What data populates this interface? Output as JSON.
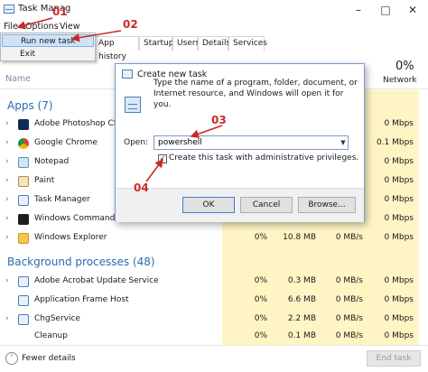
{
  "window": {
    "title": "Task Manag"
  },
  "menu": {
    "file": "File",
    "options": "Options",
    "view": "View"
  },
  "tabs": [
    "App history",
    "Startup",
    "Users",
    "Details",
    "Services"
  ],
  "columns": {
    "name": "Name",
    "network_pct": "0%",
    "network_label": "Network"
  },
  "sections": {
    "apps": "Apps (7)",
    "background": "Background processes (48)"
  },
  "apps": [
    {
      "name": "Adobe Photoshop CS2",
      "network": "0 Mbps"
    },
    {
      "name": "Google Chrome",
      "network": "0.1 Mbps"
    },
    {
      "name": "Notepad",
      "network": "0 Mbps"
    },
    {
      "name": "Paint",
      "network": "0 Mbps"
    },
    {
      "name": "Task Manager",
      "network": "0 Mbps"
    },
    {
      "name": "Windows Command Pr",
      "network": "0 Mbps"
    },
    {
      "name": "Windows Explorer",
      "cpu": "0%",
      "memory": "10.8 MB",
      "disk": "0 MB/s",
      "network": "0 Mbps"
    }
  ],
  "background": [
    {
      "name": "Adobe Acrobat Update Service",
      "cpu": "0%",
      "memory": "0.3 MB",
      "disk": "0 MB/s",
      "network": "0 Mbps"
    },
    {
      "name": "Application Frame Host",
      "cpu": "0%",
      "memory": "6.6 MB",
      "disk": "0 MB/s",
      "network": "0 Mbps"
    },
    {
      "name": "ChgService",
      "cpu": "0%",
      "memory": "2.2 MB",
      "disk": "0 MB/s",
      "network": "0 Mbps"
    },
    {
      "name": "Cleanup",
      "cpu": "0%",
      "memory": "0.1 MB",
      "disk": "0 MB/s",
      "network": "0 Mbps"
    }
  ],
  "file_menu": {
    "run_new_task": "Run new task",
    "exit": "Exit"
  },
  "dialog": {
    "title": "Create new task",
    "description": "Type the name of a program, folder, document, or Internet resource, and Windows will open it for you.",
    "open_label": "Open:",
    "open_value": "powershell",
    "admin_label": "Create this task with administrative privileges.",
    "ok": "OK",
    "cancel": "Cancel",
    "browse": "Browse..."
  },
  "footer": {
    "fewer_details": "Fewer details",
    "end_task": "End task"
  },
  "annotations": {
    "step1": "01",
    "step2": "02",
    "step3": "03",
    "step4": "04"
  },
  "colors": {
    "annotation": "#c92a2a",
    "section": "#2a6bb0",
    "datacol": "#fff4c4",
    "highlight": "#cfe3f6"
  }
}
